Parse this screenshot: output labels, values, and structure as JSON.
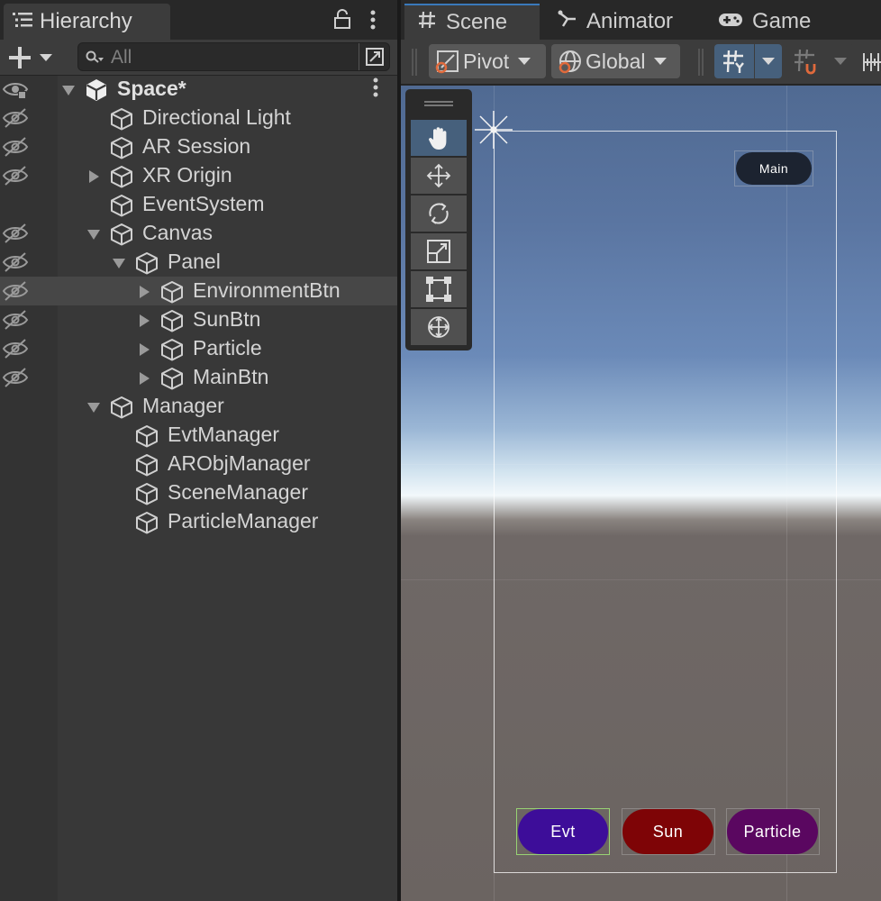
{
  "hierarchy": {
    "title": "Hierarchy",
    "search_placeholder": "All",
    "items": [
      {
        "label": "Space*",
        "depth": 0,
        "expander": "expanded",
        "icon": "unity-scene-icon",
        "bold": true,
        "visibility": "visible"
      },
      {
        "label": "Directional Light",
        "depth": 1,
        "expander": "none",
        "icon": "gameobject-cube-icon",
        "visibility": "hidden"
      },
      {
        "label": "AR Session",
        "depth": 1,
        "expander": "none",
        "icon": "gameobject-cube-icon",
        "visibility": "hidden"
      },
      {
        "label": "XR Origin",
        "depth": 1,
        "expander": "collapsed",
        "icon": "gameobject-cube-icon",
        "visibility": "hidden"
      },
      {
        "label": "EventSystem",
        "depth": 1,
        "expander": "none",
        "icon": "gameobject-cube-icon",
        "visibility": "none"
      },
      {
        "label": "Canvas",
        "depth": 1,
        "expander": "expanded",
        "icon": "gameobject-cube-icon",
        "visibility": "hidden"
      },
      {
        "label": "Panel",
        "depth": 2,
        "expander": "expanded",
        "icon": "gameobject-cube-icon",
        "visibility": "hidden"
      },
      {
        "label": "EnvironmentBtn",
        "depth": 3,
        "expander": "collapsed",
        "icon": "gameobject-cube-icon",
        "visibility": "hidden",
        "selected": true
      },
      {
        "label": "SunBtn",
        "depth": 3,
        "expander": "collapsed",
        "icon": "gameobject-cube-icon",
        "visibility": "hidden"
      },
      {
        "label": "Particle",
        "depth": 3,
        "expander": "collapsed",
        "icon": "gameobject-cube-icon",
        "visibility": "hidden"
      },
      {
        "label": "MainBtn",
        "depth": 3,
        "expander": "collapsed",
        "icon": "gameobject-cube-icon",
        "visibility": "hidden"
      },
      {
        "label": "Manager",
        "depth": 1,
        "expander": "expanded",
        "icon": "gameobject-cube-icon",
        "visibility": "none"
      },
      {
        "label": "EvtManager",
        "depth": 2,
        "expander": "none",
        "icon": "gameobject-cube-icon",
        "visibility": "none"
      },
      {
        "label": "ARObjManager",
        "depth": 2,
        "expander": "none",
        "icon": "gameobject-cube-icon",
        "visibility": "none"
      },
      {
        "label": "SceneManager",
        "depth": 2,
        "expander": "none",
        "icon": "gameobject-cube-icon",
        "visibility": "none"
      },
      {
        "label": "ParticleManager",
        "depth": 2,
        "expander": "none",
        "icon": "gameobject-cube-icon",
        "visibility": "none"
      }
    ]
  },
  "scene": {
    "tabs": [
      {
        "label": "Scene",
        "icon": "grid-hash-icon",
        "active": true
      },
      {
        "label": "Animator",
        "icon": "animator-icon",
        "active": false
      },
      {
        "label": "Game",
        "icon": "gamepad-icon",
        "active": false
      }
    ],
    "toolbar": {
      "pivot_label": "Pivot",
      "global_label": "Global"
    },
    "tools": [
      "hand-tool",
      "move-tool",
      "rotate-tool",
      "scale-tool",
      "rect-tool",
      "transform-tool"
    ],
    "active_tool": "hand-tool",
    "buttons": {
      "main": {
        "label": "Main",
        "color": "#1c2330"
      },
      "evt": {
        "label": "Evt",
        "color": "#3d0d99"
      },
      "sun": {
        "label": "Sun",
        "color": "#7e0406"
      },
      "particle": {
        "label": "Particle",
        "color": "#5a0760"
      }
    }
  },
  "colors": {
    "accent_blue": "#46607c",
    "panel_bg": "#383838"
  }
}
